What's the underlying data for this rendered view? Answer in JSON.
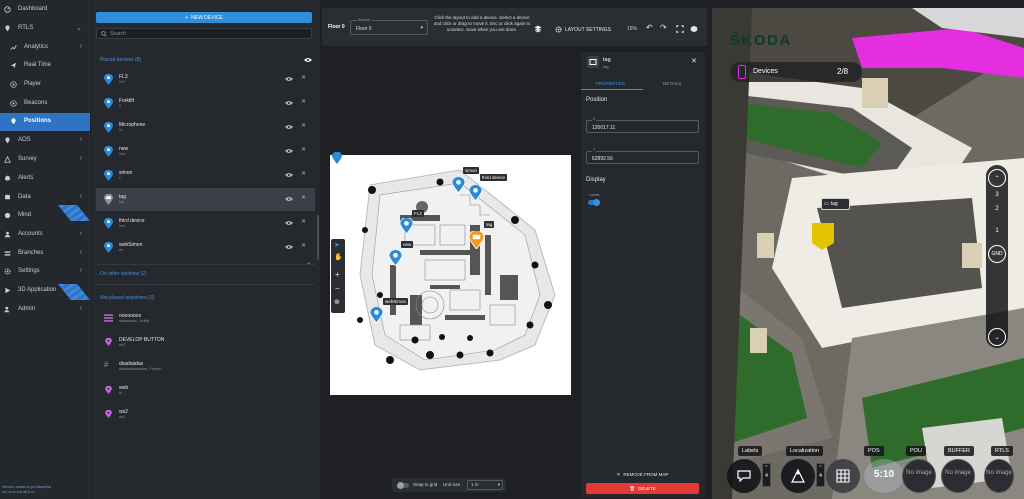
{
  "sidebar": {
    "items": [
      {
        "label": "Dashboard",
        "icon": "speedometer-icon",
        "caret": ""
      },
      {
        "label": "RTLS",
        "icon": "location-pin-icon",
        "caret": "⌄"
      },
      {
        "label": "Analytics",
        "icon": "chart-icon",
        "caret": "›"
      },
      {
        "label": "Real Time",
        "icon": "send-icon",
        "caret": ""
      },
      {
        "label": "Player",
        "icon": "play-circle-icon",
        "caret": ""
      },
      {
        "label": "Beacons",
        "icon": "beacon-icon",
        "caret": ""
      },
      {
        "label": "Positions",
        "icon": "location-pin-icon",
        "caret": ""
      },
      {
        "label": "AOS",
        "icon": "location-pin-icon",
        "caret": "›"
      },
      {
        "label": "Survey",
        "icon": "survey-icon",
        "caret": "›"
      },
      {
        "label": "Alerts",
        "icon": "bell-icon",
        "caret": ""
      },
      {
        "label": "Data",
        "icon": "database-icon",
        "caret": "›"
      },
      {
        "label": "Mind",
        "icon": "brain-icon",
        "caret": ""
      },
      {
        "label": "Accounts",
        "icon": "user-icon",
        "caret": "›"
      },
      {
        "label": "Branches",
        "icon": "branches-icon",
        "caret": "›"
      },
      {
        "label": "Settings",
        "icon": "gear-icon",
        "caret": "›"
      },
      {
        "label": "3D Application",
        "icon": "play-icon",
        "caret": ""
      },
      {
        "label": "Admin",
        "icon": "user-shield-icon",
        "caret": "›"
      }
    ],
    "version_line1": "Version: master.rc.pd.fdsaepfdd",
    "version_line2": "rev-cb.rc.1cu.ab.5.c1"
  },
  "devices": {
    "new_device_label": "NEW DEVICE",
    "search_placeholder": "Search",
    "placed_header": "Placed devices (8)",
    "placed": [
      {
        "name": "FL3",
        "sub": "fnl3",
        "selected": false
      },
      {
        "name": "Forklift",
        "sub": "fl",
        "selected": false
      },
      {
        "name": "Microphone",
        "sub": "m",
        "selected": false
      },
      {
        "name": "new",
        "sub": "new",
        "selected": false
      },
      {
        "name": "simon",
        "sub": "s",
        "selected": false
      },
      {
        "name": "tag",
        "sub": "tag",
        "selected": true
      },
      {
        "name": "third device",
        "sub": "test",
        "selected": false
      },
      {
        "name": "webSimon",
        "sub": "ws",
        "selected": false
      }
    ],
    "other_sections_label": "On other sections (2)",
    "not_placed_header": "Not placed anywhere (3)",
    "not_placed": [
      {
        "name": "oooooooo",
        "sub": "aaaaaaaaa - forklift",
        "icon": "list-icon"
      },
      {
        "name": "DEVELOP BUTTON",
        "sub": "btn7",
        "icon": "location-pin-icon"
      },
      {
        "name": "dsadsadas",
        "sub": "dsadsadsadsadas - Person",
        "icon": "hash-icon"
      },
      {
        "name": "web",
        "sub": "fs",
        "icon": "location-pin-icon"
      },
      {
        "name": "ws2",
        "sub": "ws2",
        "icon": "location-pin-icon"
      }
    ]
  },
  "toolbar": {
    "floor_label": "Floor 0",
    "section_caption": "Section",
    "section_value": "Floor 0",
    "hint": "Click the layout to add a device. Select a device and click or drag to move it. Esc or click again to unselect. Save when you are done.",
    "layout_settings": "LAYOUT SETTINGS",
    "zoom": "15%"
  },
  "map": {
    "labels": [
      "simon",
      "third device",
      "FL3",
      "tag",
      "new",
      "webSimon"
    ]
  },
  "snap": {
    "label": "Snap to grid",
    "unit_label": "Unit size",
    "unit_value": "1 m"
  },
  "properties": {
    "title": "tag",
    "subtitle": "tag",
    "tab_properties": "PROPERTIES",
    "tab_details": "DETAILS",
    "position_header": "Position",
    "x_caption": "X",
    "x_value": "120017.11",
    "y_caption": "Y",
    "y_value": "62892.56",
    "display_header": "Display",
    "labels_caption": "Labels",
    "labels_on": true,
    "remove_label": "REMOVE FROM MAP",
    "delete_label": "DELETE"
  },
  "view3d": {
    "brand": "ŠKODA",
    "devices_label": "Devices",
    "devices_count": "2/8",
    "floors": [
      "3",
      "2",
      "1",
      "GND"
    ],
    "tag_chip": "tag",
    "bottom_labels": [
      "Labels",
      "Localization",
      "POS",
      "POU",
      "BUFFER",
      "RTLS"
    ],
    "stepper_value": "4",
    "no_image": "No image",
    "clock": "5:10"
  },
  "colors": {
    "accent": "#2f8fdc",
    "delete": "#e53935",
    "pin_blue": "#2a8bd6",
    "pin_orange": "#f39a1e",
    "magenta": "#e52ee0"
  }
}
